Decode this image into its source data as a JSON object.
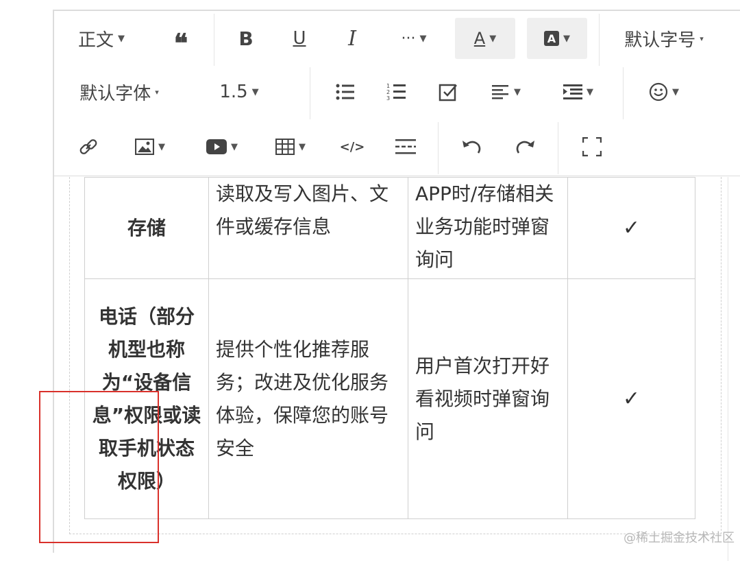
{
  "toolbar": {
    "row1": {
      "paragraph_style": "正文",
      "default_font_size": "默认字号"
    },
    "row2": {
      "default_font": "默认字体",
      "line_height": "1.5"
    }
  },
  "table": {
    "rows": [
      {
        "permission": "存储",
        "purpose": "读取及写入图片、文件或缓存信息",
        "timing": "APP时/存储相关业务功能时弹窗询问",
        "check": "✓"
      },
      {
        "permission": "电话（部分机型也称为“设备信息”权限或读取手机状态权限）",
        "purpose": "提供个性化推荐服务；改进及优化服务体验，保障您的账号安全",
        "timing": "用户首次打开好看视频时弹窗询问",
        "check": "✓"
      }
    ]
  },
  "watermark": "@稀土掘金技术社区",
  "colors": {
    "highlight_box": "#d9302a",
    "border": "#cfcfcf"
  }
}
